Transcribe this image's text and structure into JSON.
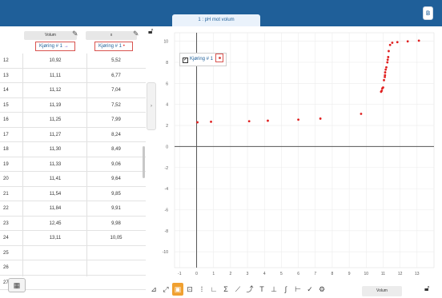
{
  "window": {
    "tab_title": "1 : pH mot volum"
  },
  "table": {
    "columns": [
      {
        "name": "Volum",
        "run": "Kjøring # 1"
      },
      {
        "name": "x",
        "run": "Kjøring # 1"
      }
    ],
    "rows": [
      {
        "n": "12",
        "a": "10,92",
        "b": "5,52"
      },
      {
        "n": "13",
        "a": "11,11",
        "b": "6,77"
      },
      {
        "n": "14",
        "a": "11,12",
        "b": "7,04"
      },
      {
        "n": "15",
        "a": "11,19",
        "b": "7,52"
      },
      {
        "n": "16",
        "a": "11,25",
        "b": "7,99"
      },
      {
        "n": "17",
        "a": "11,27",
        "b": "8,24"
      },
      {
        "n": "18",
        "a": "11,30",
        "b": "8,49"
      },
      {
        "n": "19",
        "a": "11,33",
        "b": "9,06"
      },
      {
        "n": "20",
        "a": "11,41",
        "b": "9,64"
      },
      {
        "n": "21",
        "a": "11,54",
        "b": "9,85"
      },
      {
        "n": "22",
        "a": "11,84",
        "b": "9,91"
      },
      {
        "n": "23",
        "a": "12,45",
        "b": "9,98"
      },
      {
        "n": "24",
        "a": "13,11",
        "b": "10,05"
      },
      {
        "n": "25",
        "a": "",
        "b": ""
      },
      {
        "n": "26",
        "a": "",
        "b": ""
      },
      {
        "n": "27",
        "a": "",
        "b": ""
      }
    ]
  },
  "legend": {
    "label": "Kjøring # 1"
  },
  "toolbar": {
    "x_axis_select": "Volum"
  },
  "colors": {
    "topbar": "#1f5f99",
    "marker": "#e02020",
    "accent": "#f0a030"
  },
  "chart_data": {
    "type": "scatter",
    "title": "",
    "xlabel": "",
    "ylabel": "",
    "xlim": [
      -1.3,
      14
    ],
    "ylim": [
      -11.5,
      10.8
    ],
    "x_ticks": [
      -1,
      0,
      1,
      2,
      3,
      4,
      5,
      6,
      7,
      8,
      9,
      10,
      11,
      12,
      13
    ],
    "y_ticks": [
      -10,
      -8,
      -6,
      -4,
      -2,
      0,
      2,
      4,
      6,
      8,
      10
    ],
    "grid": true,
    "legend_position": "top-left",
    "series": [
      {
        "name": "Kjøring # 1",
        "x": [
          0.05,
          0.85,
          3.1,
          4.2,
          6.0,
          7.3,
          9.7,
          10.88,
          10.92,
          10.95,
          11.0,
          11.05,
          11.1,
          11.11,
          11.12,
          11.15,
          11.19,
          11.25,
          11.27,
          11.3,
          11.33,
          11.41,
          11.54,
          11.84,
          12.45,
          13.11
        ],
        "y": [
          2.3,
          2.35,
          2.4,
          2.45,
          2.55,
          2.65,
          3.1,
          5.2,
          5.3,
          5.52,
          5.6,
          6.3,
          6.6,
          6.77,
          7.04,
          7.3,
          7.52,
          7.99,
          8.24,
          8.49,
          9.06,
          9.64,
          9.85,
          9.91,
          9.98,
          10.05
        ]
      }
    ]
  }
}
